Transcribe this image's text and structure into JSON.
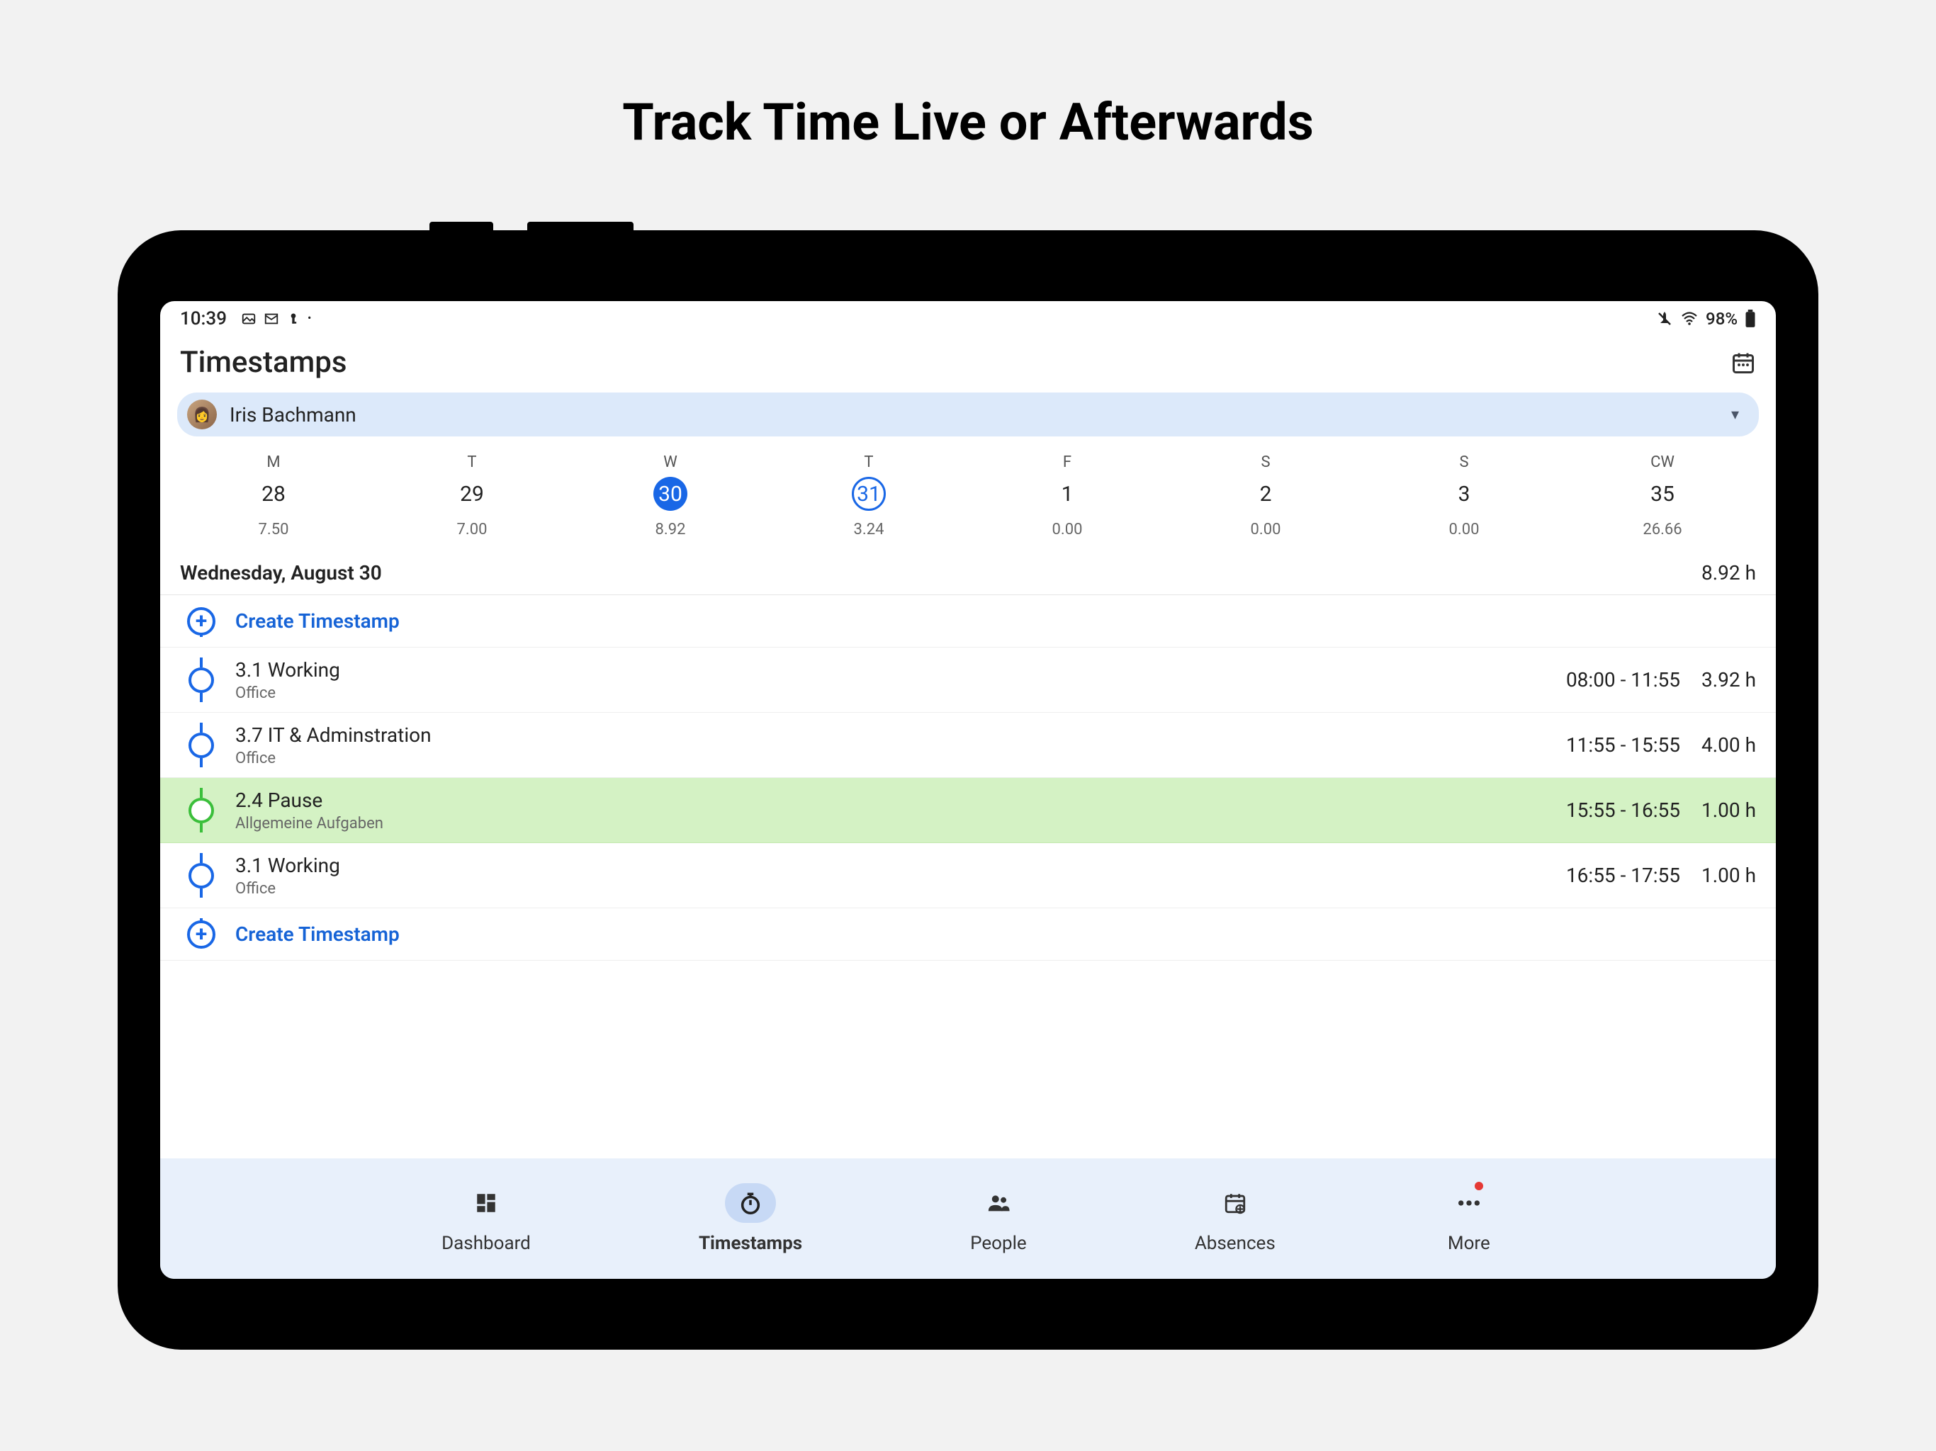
{
  "hero": {
    "title": "Track Time Live or Afterwards"
  },
  "status": {
    "time": "10:39",
    "battery": "98%"
  },
  "header": {
    "title": "Timestamps"
  },
  "user": {
    "name": "Iris Bachmann"
  },
  "week": {
    "days": [
      {
        "letter": "M",
        "num": "28",
        "hours": "7.50",
        "state": ""
      },
      {
        "letter": "T",
        "num": "29",
        "hours": "7.00",
        "state": ""
      },
      {
        "letter": "W",
        "num": "30",
        "hours": "8.92",
        "state": "selected"
      },
      {
        "letter": "T",
        "num": "31",
        "hours": "3.24",
        "state": "outlined"
      },
      {
        "letter": "F",
        "num": "1",
        "hours": "0.00",
        "state": ""
      },
      {
        "letter": "S",
        "num": "2",
        "hours": "0.00",
        "state": ""
      },
      {
        "letter": "S",
        "num": "3",
        "hours": "0.00",
        "state": ""
      },
      {
        "letter": "CW",
        "num": "35",
        "hours": "26.66",
        "state": ""
      }
    ]
  },
  "summary": {
    "date_label": "Wednesday, August 30",
    "total": "8.92 h"
  },
  "actions": {
    "create_label": "Create Timestamp"
  },
  "entries": [
    {
      "title": "3.1 Working",
      "sub": "Office",
      "range": "08:00 - 11:55",
      "dur": "3.92 h",
      "kind": "work"
    },
    {
      "title": "3.7 IT & Adminstration",
      "sub": "Office",
      "range": "11:55 - 15:55",
      "dur": "4.00 h",
      "kind": "work"
    },
    {
      "title": "2.4 Pause",
      "sub": "Allgemeine Aufgaben",
      "range": "15:55 - 16:55",
      "dur": "1.00 h",
      "kind": "pause"
    },
    {
      "title": "3.1 Working",
      "sub": "Office",
      "range": "16:55 - 17:55",
      "dur": "1.00 h",
      "kind": "work"
    }
  ],
  "nav": {
    "items": [
      {
        "label": "Dashboard",
        "icon": "dashboard",
        "active": false,
        "dot": false
      },
      {
        "label": "Timestamps",
        "icon": "stopwatch",
        "active": true,
        "dot": false
      },
      {
        "label": "People",
        "icon": "people",
        "active": false,
        "dot": false
      },
      {
        "label": "Absences",
        "icon": "calendar",
        "active": false,
        "dot": false
      },
      {
        "label": "More",
        "icon": "more",
        "active": false,
        "dot": true
      }
    ]
  }
}
